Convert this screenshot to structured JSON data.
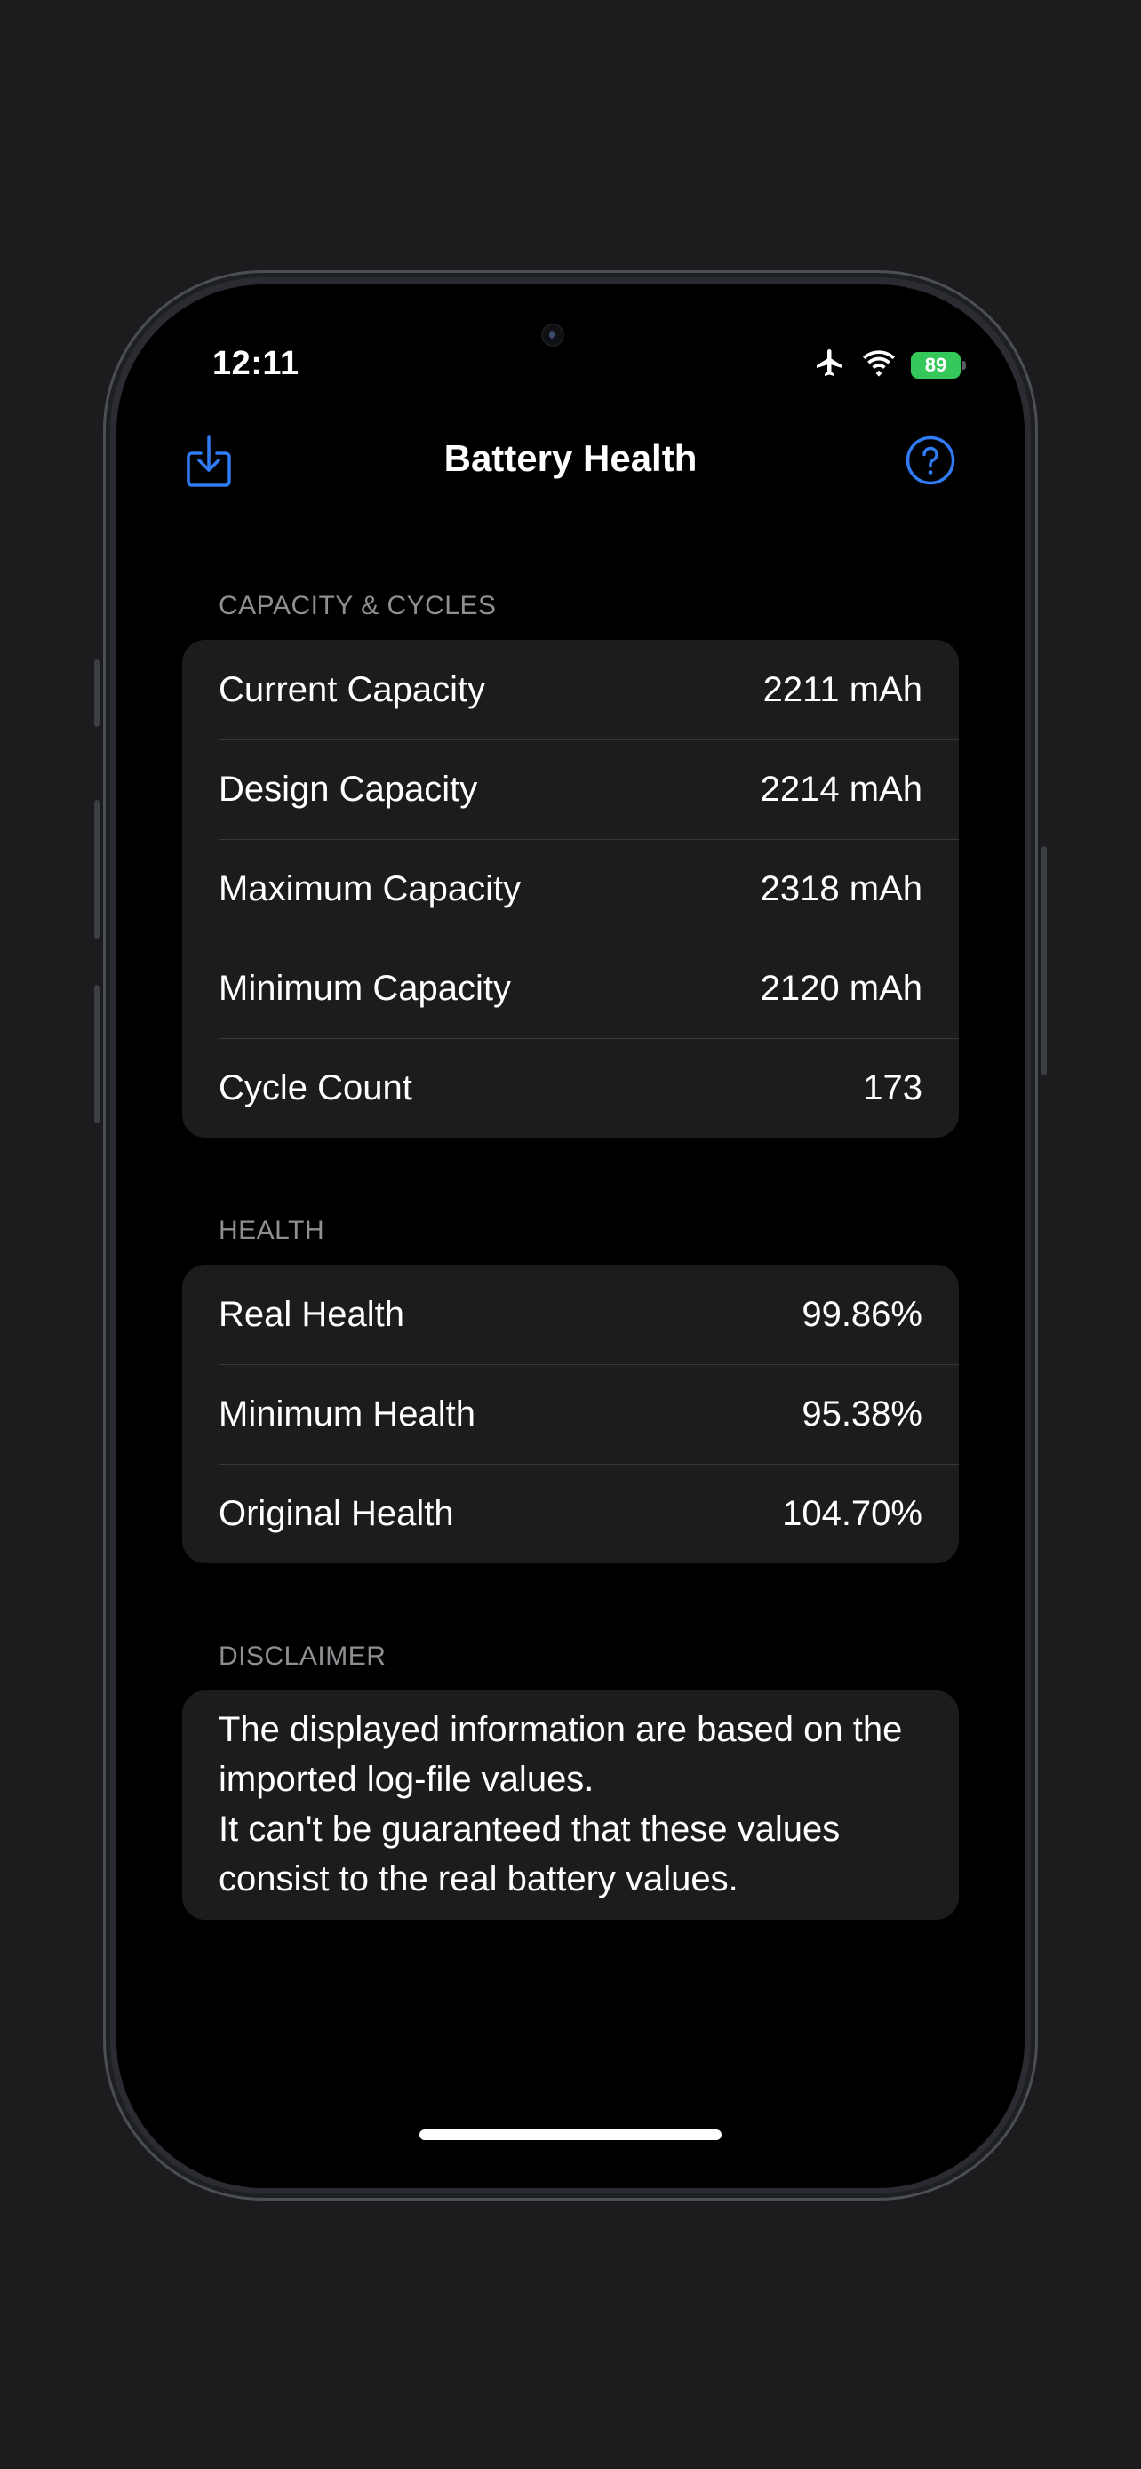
{
  "status_bar": {
    "time": "12:11",
    "battery_level": "89"
  },
  "nav": {
    "title": "Battery Health"
  },
  "sections": [
    {
      "header": "CAPACITY & CYCLES",
      "rows": [
        {
          "label": "Current Capacity",
          "value": "2211 mAh"
        },
        {
          "label": "Design Capacity",
          "value": "2214 mAh"
        },
        {
          "label": "Maximum Capacity",
          "value": "2318 mAh"
        },
        {
          "label": "Minimum Capacity",
          "value": "2120 mAh"
        },
        {
          "label": "Cycle Count",
          "value": "173"
        }
      ]
    },
    {
      "header": "HEALTH",
      "rows": [
        {
          "label": "Real Health",
          "value": "99.86%"
        },
        {
          "label": "Minimum Health",
          "value": "95.38%"
        },
        {
          "label": "Original Health",
          "value": "104.70%"
        }
      ]
    }
  ],
  "disclaimer": {
    "header": "DISCLAIMER",
    "line1": "The displayed information are based on the imported log-file values.",
    "line2": "It can't be guaranteed that these values consist to the real battery values."
  },
  "colors": {
    "accent": "#2f7cf6",
    "battery_green": "#34c759",
    "card": "#1c1c1e",
    "background": "#000000"
  }
}
